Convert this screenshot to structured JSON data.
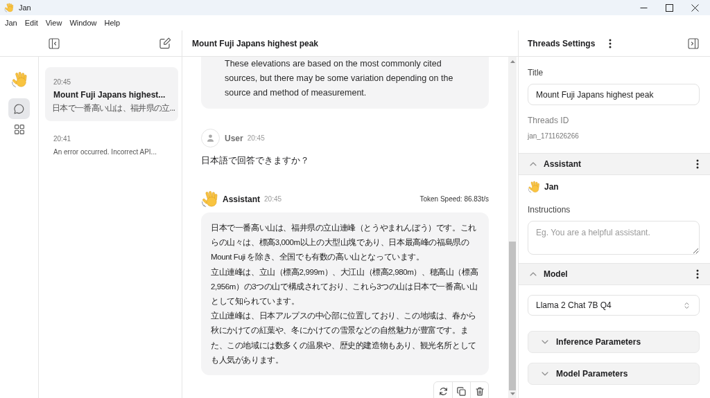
{
  "window": {
    "title": "Jan"
  },
  "menu": [
    "Jan",
    "Edit",
    "View",
    "Window",
    "Help"
  ],
  "rail": [
    {
      "kind": "chat",
      "selected": true
    },
    {
      "kind": "apps",
      "selected": false
    }
  ],
  "threads": [
    {
      "time": "20:45",
      "title": "Mount Fuji Japans highest...",
      "preview": "日本で一番高い山は、福井県の立...",
      "selected": true
    },
    {
      "time": "20:41",
      "preview": "An error occurred. Incorrect API...",
      "selected": false
    }
  ],
  "chat": {
    "title": "Mount Fuji Japans highest peak",
    "messages": [
      {
        "kind": "partial",
        "paragraphs": [
          "These elevations are based on the most commonly cited sources, but there may be some variation depending on the source and method of measurement."
        ]
      },
      {
        "kind": "user",
        "author": "User",
        "time": "20:45",
        "text": "日本語で回答できますか？"
      },
      {
        "kind": "assistant",
        "author": "Assistant",
        "time": "20:45",
        "token_speed": "Token Speed: 86.83t/s",
        "paragraphs": [
          "日本で一番高い山は、福井県の立山連峰（とうやまれんぼう）です。これらの山々は、標高3,000m以上の大型山塊であり、日本最高峰の福島県のMount Fuji を除き、全国でも有数の高い山となっています。",
          "立山連峰は、立山（標高2,999m）、大江山（標高2,980m）、穂高山（標高2,956m）の3つの山で構成されており、これら3つの山は日本で一番高い山として知られています。",
          "立山連峰は、日本アルプスの中心部に位置しており、この地域は、春から秋にかけての紅葉や、冬にかけての雪景などの自然魅力が豊富です。また、この地域には数多くの温泉や、歴史的建造物もあり、観光名所としても人気があります。"
        ]
      }
    ]
  },
  "settings": {
    "heading": "Threads Settings",
    "title": {
      "label": "Title",
      "value": "Mount Fuji Japans highest peak"
    },
    "thread_id": {
      "label": "Threads ID",
      "value": "jan_1711626266"
    },
    "assistant": {
      "label": "Assistant",
      "expanded": true,
      "name": "Jan",
      "instructions": {
        "label": "Instructions",
        "placeholder": "Eg. You are a helpful assistant."
      }
    },
    "model": {
      "label": "Model",
      "expanded": true,
      "selected_model": "Llama 2 Chat 7B Q4",
      "groups": [
        {
          "label": "Inference Parameters",
          "expanded": false
        },
        {
          "label": "Model Parameters",
          "expanded": false
        }
      ]
    }
  }
}
